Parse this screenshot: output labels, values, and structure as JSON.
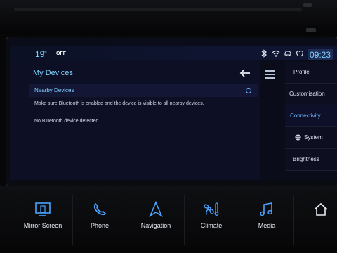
{
  "status_bar": {
    "temperature": "19",
    "temperature_unit": "c",
    "climate_status": "OFF",
    "clock": "09:23",
    "icons": [
      "bluetooth-icon",
      "wifi-icon",
      "car-icon",
      "location-heart-icon"
    ]
  },
  "page": {
    "title": "My Devices",
    "section_label": "Nearby Devices",
    "info_text": "Make sure Bluetooth is enabled and the device is visible to all nearby devices.",
    "empty_text": "No Bluetooth device detected."
  },
  "side_menu": {
    "items": [
      {
        "label": "Profile"
      },
      {
        "label": "Customisation"
      },
      {
        "label": "Connectivity",
        "active": true
      },
      {
        "label": "System"
      },
      {
        "label": "Brightness"
      }
    ]
  },
  "bottom_nav": {
    "items": [
      {
        "label": "Mirror Screen",
        "icon": "mirror-screen-icon"
      },
      {
        "label": "Phone",
        "icon": "phone-icon"
      },
      {
        "label": "Navigation",
        "icon": "navigation-icon"
      },
      {
        "label": "Climate",
        "icon": "climate-icon"
      },
      {
        "label": "Media",
        "icon": "media-icon"
      },
      {
        "label": "",
        "icon": "home-icon"
      }
    ]
  },
  "colors": {
    "accent": "#7fd3ff",
    "active_tab": "#6fb8ff",
    "background": "#0d0f24"
  }
}
